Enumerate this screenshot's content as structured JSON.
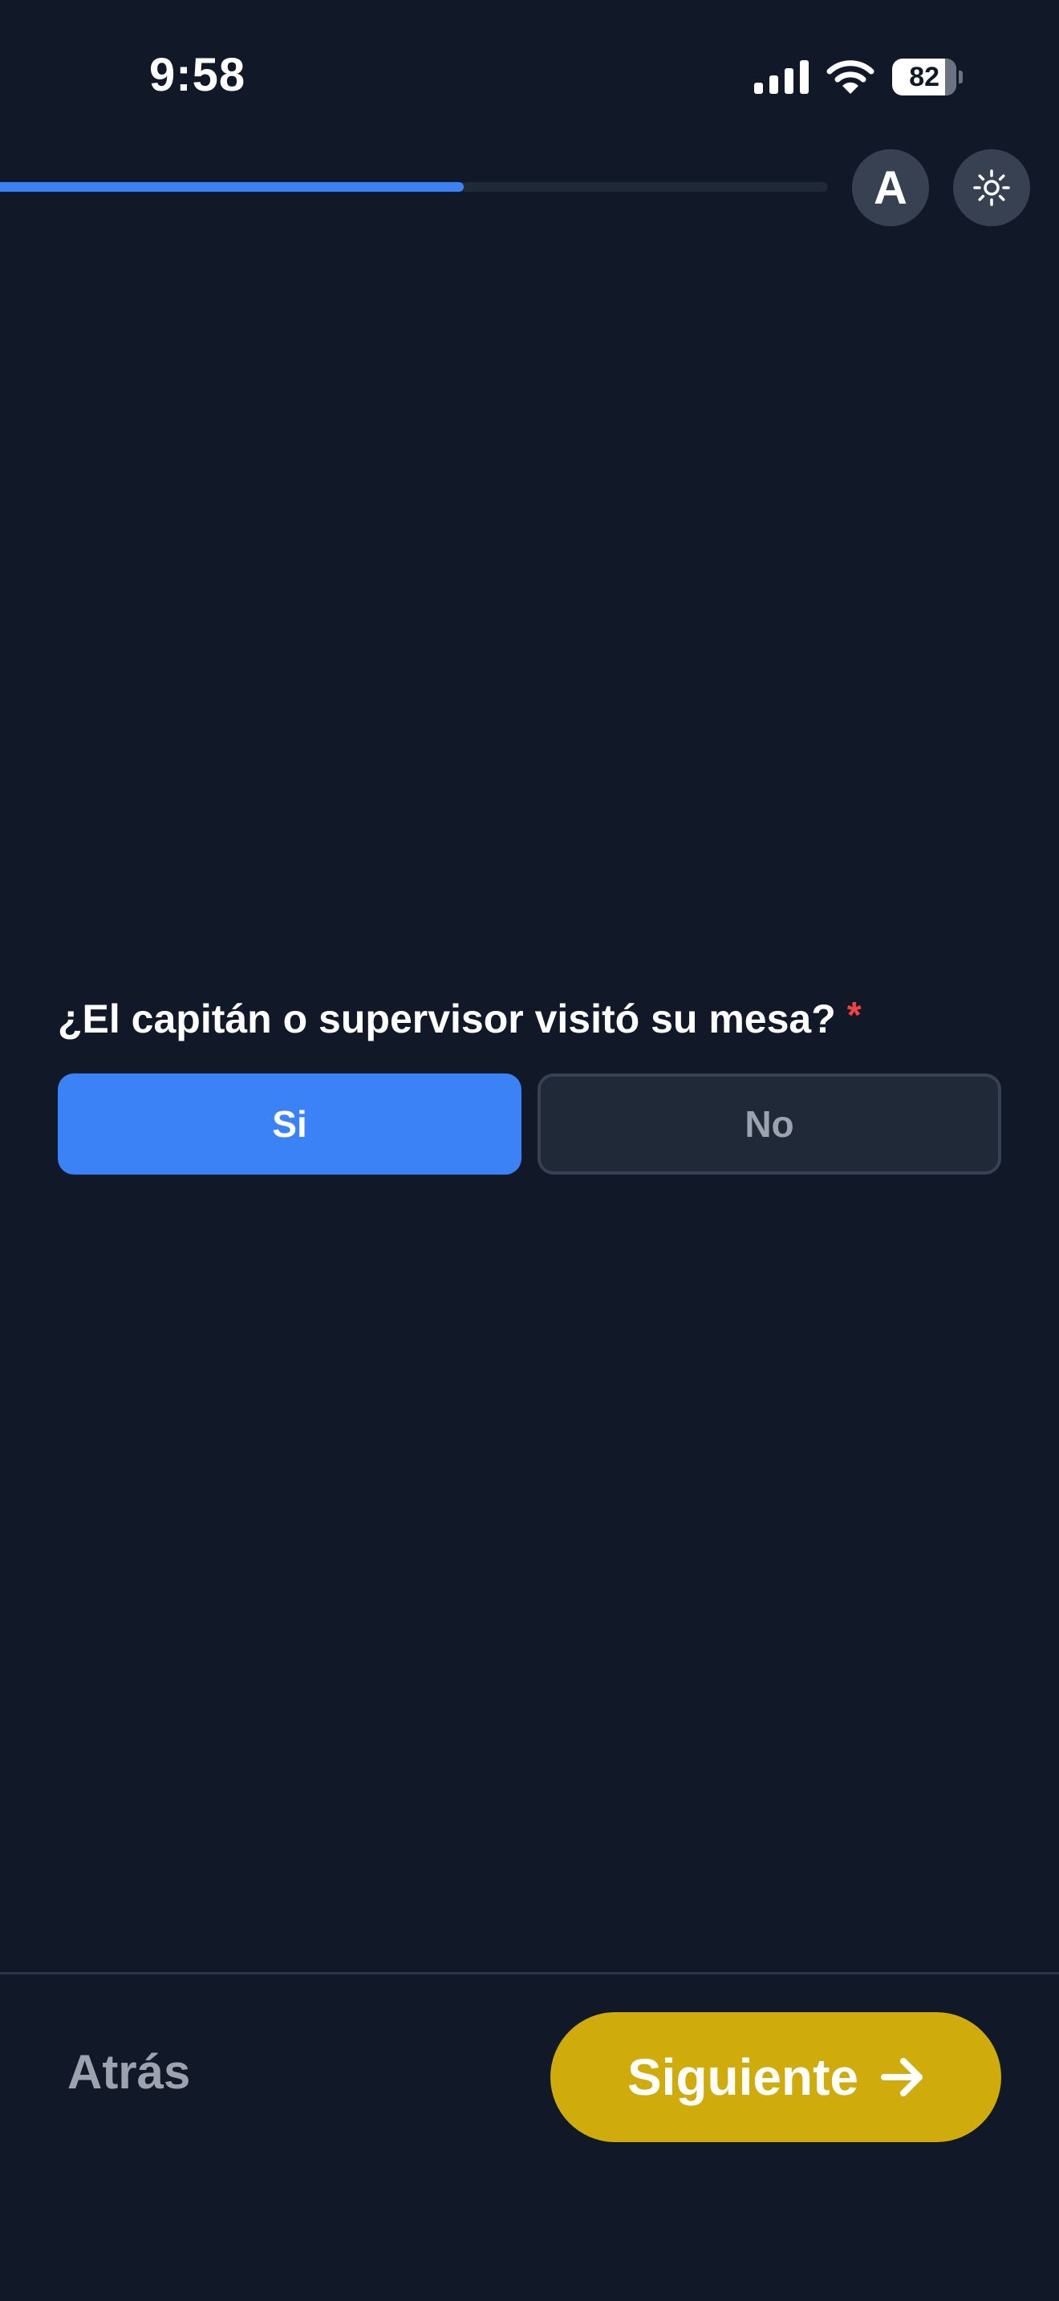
{
  "status_bar": {
    "time": "9:58",
    "battery_level": "82",
    "icons": [
      "signal-icon",
      "wifi-icon",
      "battery-icon"
    ]
  },
  "toolbar": {
    "progress_fraction": 0.56,
    "font_size_button_label": "A",
    "theme_toggle_icon": "sun-icon"
  },
  "question": {
    "label": "¿El capitán o supervisor visitó su mesa?",
    "required_marker": "*",
    "options": [
      {
        "label": "Si",
        "selected": true
      },
      {
        "label": "No",
        "selected": false
      }
    ]
  },
  "footer": {
    "back_label": "Atrás",
    "next_label": "Siguiente",
    "next_icon": "arrow-right-icon"
  },
  "colors": {
    "background": "#111827",
    "accent": "#3b82f6",
    "next_button": "#cfac0c",
    "required": "#ef4444"
  }
}
